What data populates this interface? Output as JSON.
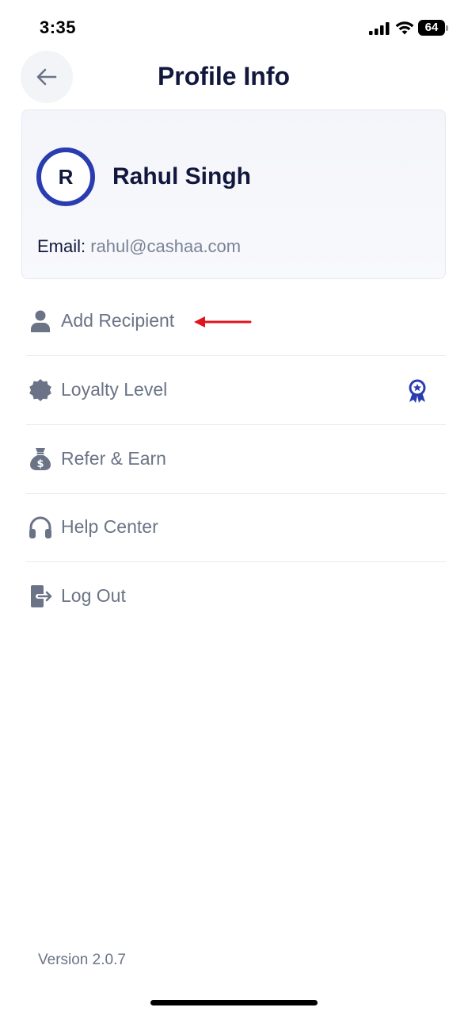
{
  "status_bar": {
    "time": "3:35",
    "battery_level": "64"
  },
  "header": {
    "title": "Profile Info",
    "back_icon": "arrow-left-icon"
  },
  "profile": {
    "avatar_initial": "R",
    "name": "Rahul Singh",
    "email_label": "Email:",
    "email_value": "rahul@cashaa.com",
    "avatar_ring_color": "#2a3db0"
  },
  "menu": {
    "items": [
      {
        "label": "Add Recipient",
        "icon": "person-icon"
      },
      {
        "label": "Loyalty Level",
        "icon": "badge-icon",
        "trailing_icon": "award-ribbon-icon"
      },
      {
        "label": "Refer & Earn",
        "icon": "money-bag-icon"
      },
      {
        "label": "Help Center",
        "icon": "headphones-icon"
      },
      {
        "label": "Log Out",
        "icon": "logout-icon"
      }
    ]
  },
  "annotation": {
    "icon": "red-arrow-icon",
    "color": "#e0141e"
  },
  "footer": {
    "version": "Version 2.0.7"
  },
  "colors": {
    "title": "#12183d",
    "muted": "#6b7386",
    "accent": "#2a3db0"
  }
}
